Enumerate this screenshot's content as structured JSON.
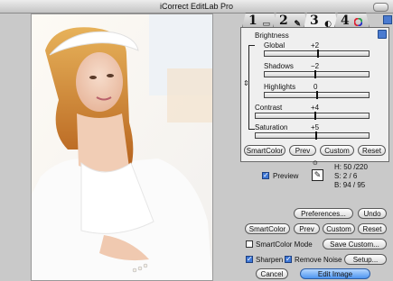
{
  "window": {
    "title": "iCorrect EditLab Pro"
  },
  "tabs": [
    {
      "number": "1",
      "icon": "monitor-icon"
    },
    {
      "number": "2",
      "icon": "brush-icon"
    },
    {
      "number": "3",
      "icon": "levels-icon"
    },
    {
      "number": "4",
      "icon": "color-wheel-icon"
    }
  ],
  "active_tab": "3",
  "sliders": {
    "brightness_label": "Brightness",
    "global": {
      "label": "Global",
      "value": "+2",
      "level": 0.51
    },
    "shadows": {
      "label": "Shadows",
      "value": "−2",
      "level": 0.49
    },
    "highlights": {
      "label": "Highlights",
      "value": "0",
      "level": 0.5
    },
    "contrast": {
      "label": "Contrast",
      "value": "+4",
      "level": 0.52
    },
    "saturation": {
      "label": "Saturation",
      "value": "+5",
      "level": 0.525
    }
  },
  "panel_buttons": {
    "smartcolor": "SmartColor",
    "prev": "Prev",
    "custom": "Custom",
    "reset": "Reset"
  },
  "preview": {
    "label": "Preview",
    "checked": true
  },
  "color_readout": {
    "h": "H:  50  /220",
    "s": "S:    2  /   6",
    "b": "B:  94  /  95"
  },
  "buttons": {
    "preferences": "Preferences...",
    "undo": "Undo",
    "smartcolor": "SmartColor",
    "prev": "Prev",
    "custom": "Custom",
    "reset": "Reset",
    "save_custom": "Save Custom...",
    "setup": "Setup...",
    "cancel": "Cancel",
    "edit_image": "Edit Image"
  },
  "checkboxes": {
    "smartcolor_mode": {
      "label": "SmartColor Mode",
      "checked": false
    },
    "sharpen": {
      "label": "Sharpen",
      "checked": true
    },
    "remove_noise": {
      "label": "Remove Noise",
      "checked": true
    }
  },
  "colors": {
    "default_button": "#4d95f1",
    "window_bg": "#c9c9c9",
    "panel_bg": "#efefef"
  }
}
